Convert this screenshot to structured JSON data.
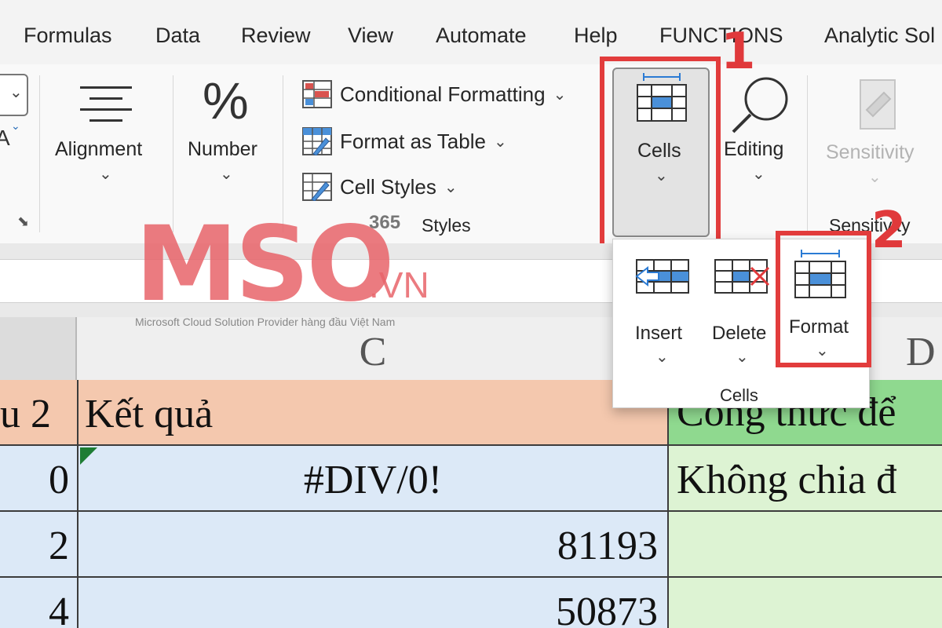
{
  "menu": {
    "tabs": [
      "Formulas",
      "Data",
      "Review",
      "View",
      "Automate",
      "Help",
      "FUNCTIONS",
      "Analytic Sol"
    ]
  },
  "ribbon": {
    "font_partial_glyph": "A",
    "alignment_label": "Alignment",
    "number_label": "Number",
    "number_icon": "%",
    "styles": {
      "conditional_formatting": "Conditional Formatting",
      "format_as_table": "Format as Table",
      "cell_styles": "Cell Styles",
      "group_label": "Styles"
    },
    "cells_label": "Cells",
    "editing_label": "Editing",
    "sensitivity_label": "Sensitivity",
    "sensitivity_group_label": "Sensitivity"
  },
  "dropdown": {
    "insert_label": "Insert",
    "delete_label": "Delete",
    "format_label": "Format",
    "group_label": "Cells"
  },
  "grid": {
    "column_headers": [
      "C",
      "D"
    ],
    "rows": [
      {
        "b": "u 2",
        "c": "Kết quả",
        "d": "Công thức để"
      },
      {
        "b": "0",
        "c": "#DIV/0!",
        "d": "Không chia đ"
      },
      {
        "b": "2",
        "c": "81193",
        "d": ""
      },
      {
        "b": "4",
        "c": "50873",
        "d": ""
      }
    ]
  },
  "callouts": [
    "1",
    "2"
  ],
  "watermark": {
    "logo_text": "MSO",
    "domain": ".VN",
    "number": "365",
    "tagline": "Microsoft Cloud Solution Provider hàng đầu Việt Nam"
  },
  "colors": {
    "accent_red": "#e23c3c",
    "header_row": "#f4c8ae",
    "header_row_green": "#8fd98f",
    "data_row_blue": "#dce9f7",
    "data_row_green": "#ddf3d3",
    "watermark": "#e8646a"
  }
}
